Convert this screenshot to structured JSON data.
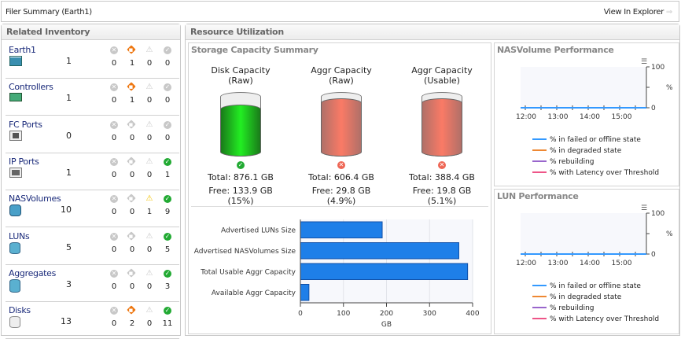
{
  "header": {
    "title": "Filer Summary (Earth1)",
    "link": "View In Explorer"
  },
  "inventory": {
    "title": "Related Inventory",
    "items": [
      {
        "name": "Earth1",
        "icon": "server-icon",
        "count": "1",
        "status": [
          "0",
          "1",
          "0",
          "0"
        ],
        "active": [
          false,
          true,
          false,
          false
        ]
      },
      {
        "name": "Controllers",
        "icon": "controller-board-icon",
        "count": "1",
        "status": [
          "0",
          "1",
          "0",
          "0"
        ],
        "active": [
          false,
          true,
          false,
          false
        ]
      },
      {
        "name": "FC Ports",
        "icon": "fc-port-icon",
        "count": "0",
        "status": [
          "0",
          "0",
          "0",
          "0"
        ],
        "active": [
          false,
          false,
          false,
          false
        ]
      },
      {
        "name": "IP Ports",
        "icon": "ethernet-port-icon",
        "count": "1",
        "status": [
          "0",
          "0",
          "0",
          "1"
        ],
        "active": [
          false,
          false,
          false,
          true
        ]
      },
      {
        "name": "NASVolumes",
        "icon": "nas-volume-icon",
        "count": "10",
        "status": [
          "0",
          "0",
          "1",
          "9"
        ],
        "active": [
          false,
          false,
          true,
          true
        ]
      },
      {
        "name": "LUNs",
        "icon": "lun-database-icon",
        "count": "5",
        "status": [
          "0",
          "0",
          "0",
          "5"
        ],
        "active": [
          false,
          false,
          false,
          true
        ]
      },
      {
        "name": "Aggregates",
        "icon": "aggregate-database-icon",
        "count": "3",
        "status": [
          "0",
          "0",
          "0",
          "3"
        ],
        "active": [
          false,
          false,
          false,
          true
        ]
      },
      {
        "name": "Disks",
        "icon": "disk-icon",
        "count": "13",
        "status": [
          "0",
          "2",
          "0",
          "11"
        ],
        "active": [
          false,
          true,
          false,
          true
        ]
      }
    ],
    "status_icons": [
      "fatal-icon",
      "critical-icon",
      "warning-icon",
      "normal-icon"
    ]
  },
  "resource": {
    "title": "Resource Utilization",
    "storage": {
      "title": "Storage Capacity Summary",
      "cylinders": [
        {
          "title1": "Disk Capacity",
          "title2": "(Raw)",
          "total": "Total: 876.1 GB",
          "free": "Free: 133.9 GB (15%)",
          "status": "ok",
          "color": "#22bb22",
          "fill_percent": 85
        },
        {
          "title1": "Aggr Capacity",
          "title2": "(Raw)",
          "total": "Total: 606.4 GB",
          "free": "Free: 29.8 GB (4.9%)",
          "status": "error",
          "color": "#f07060",
          "fill_percent": 95.1
        },
        {
          "title1": "Aggr Capacity",
          "title2": "(Usable)",
          "total": "Total: 388.4 GB",
          "free": "Free: 19.8 GB (5.1%)",
          "status": "error",
          "color": "#f07060",
          "fill_percent": 94.9
        }
      ]
    },
    "nas_perf": {
      "title": "NASVolume Performance"
    },
    "lun_perf": {
      "title": "LUN Performance"
    }
  },
  "chart_data": [
    {
      "type": "bar",
      "orientation": "horizontal",
      "categories": [
        "Advertised LUNs Size",
        "Advertised NASVolumes Size",
        "Total Usable Aggr Capacity",
        "Available Aggr Capacity"
      ],
      "values": [
        190,
        368,
        388.4,
        19.8
      ],
      "xlabel": "GB",
      "xlim": [
        0,
        400
      ],
      "xticks": [
        "0",
        "100",
        "200",
        "300",
        "400"
      ],
      "color": "#1e7fe8",
      "grid": true
    },
    {
      "type": "line",
      "title": "NASVolume Performance",
      "x": [
        "12:00",
        "13:00",
        "14:00",
        "15:00"
      ],
      "ylabel": "%",
      "ylim": [
        0,
        100
      ],
      "yticks": [
        "0",
        "100"
      ],
      "series": [
        {
          "name": "% in failed or offline state",
          "color": "#3399ff",
          "values": [
            0,
            0,
            0,
            0
          ]
        },
        {
          "name": "% in degraded state",
          "color": "#ee8833",
          "values": [
            0,
            0,
            0,
            0
          ]
        },
        {
          "name": "% rebuilding",
          "color": "#9966cc",
          "values": [
            0,
            0,
            0,
            0
          ]
        },
        {
          "name": "% with Latency over Threshold",
          "color": "#ee5588",
          "values": [
            0,
            0,
            0,
            0
          ]
        }
      ]
    },
    {
      "type": "line",
      "title": "LUN Performance",
      "x": [
        "12:00",
        "13:00",
        "14:00",
        "15:00"
      ],
      "ylabel": "%",
      "ylim": [
        0,
        100
      ],
      "yticks": [
        "0",
        "100"
      ],
      "series": [
        {
          "name": "% in failed or offline state",
          "color": "#3399ff",
          "values": [
            0,
            0,
            0,
            0
          ]
        },
        {
          "name": "% in degraded state",
          "color": "#ee8833",
          "values": [
            0,
            0,
            0,
            0
          ]
        },
        {
          "name": "% rebuilding",
          "color": "#9966cc",
          "values": [
            0,
            0,
            0,
            0
          ]
        },
        {
          "name": "% with Latency over Threshold",
          "color": "#ee5588",
          "values": [
            0,
            0,
            0,
            0
          ]
        }
      ]
    }
  ]
}
